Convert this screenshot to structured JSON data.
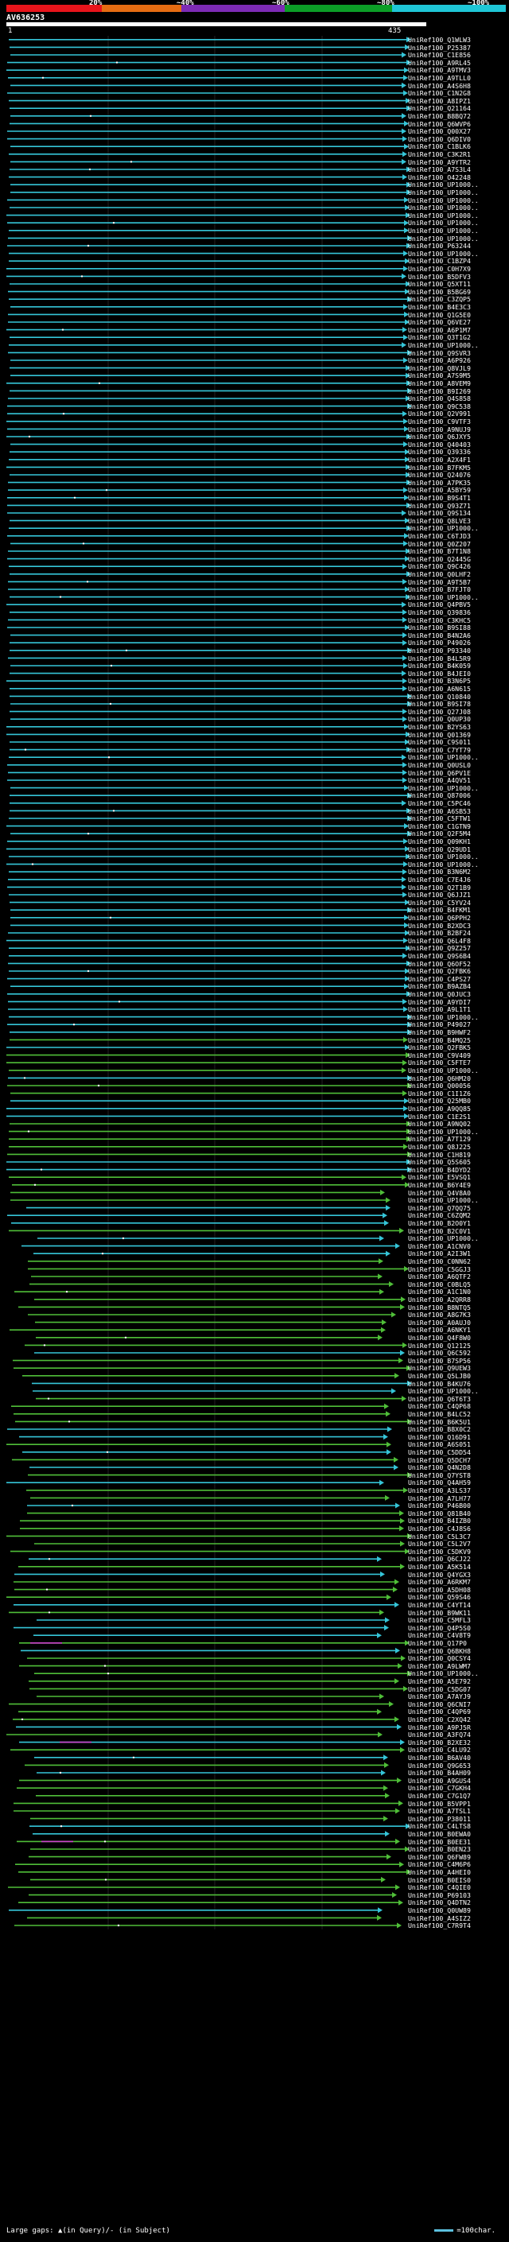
{
  "colors": {
    "bg": "#000000",
    "band": [
      "#e8141b",
      "#e66c12",
      "#7d2bb5",
      "#0c9e27",
      "#1fc6d6"
    ],
    "hit_high": "#35c5d8",
    "hit_mid": "#4fbe38",
    "gap": "#cc44cc",
    "grid": "#444444"
  },
  "header": {
    "pct_labels": [
      "20%",
      "~40%",
      "~60%",
      "~80%",
      "~100%"
    ],
    "query_id": "AV636253",
    "query_start": "1",
    "query_end": "435"
  },
  "hits": [
    "UniRef100_Q1WLW3",
    "UniRef100_P25387",
    "UniRef100_C1E856",
    "UniRef100_A9RL45",
    "UniRef100_A9TMV3",
    "UniRef100_A9TLL0",
    "UniRef100_A4S6H8",
    "UniRef100_C1N2G8",
    "UniRef100_A8IPZ1",
    "UniRef100_Q21164",
    "UniRef100_B8BQ72",
    "UniRef100_Q6WVP6",
    "UniRef100_Q00X27",
    "UniRef100_Q6DIV0",
    "UniRef100_C1BLK6",
    "UniRef100_C3K2R1",
    "UniRef100_A9YTR2",
    "UniRef100_A7S3L4",
    "UniRef100_O42248",
    "UniRef100_UP1000..",
    "UniRef100_UP1000..",
    "UniRef100_UP1000..",
    "UniRef100_UP1000..",
    "UniRef100_UP1000..",
    "UniRef100_UP1000..",
    "UniRef100_UP1000..",
    "UniRef100_UP1000..",
    "UniRef100_P63244",
    "UniRef100_UP1000..",
    "UniRef100_C1BZP4",
    "UniRef100_C0H7X9",
    "UniRef100_B5DFV3",
    "UniRef100_Q5XT11",
    "UniRef100_B5BG69",
    "UniRef100_C3ZQP5",
    "UniRef100_B4E3C3",
    "UniRef100_Q1G5E0",
    "UniRef100_Q6VE27",
    "UniRef100_A6P1M7",
    "UniRef100_Q3T1G2",
    "UniRef100_UP1000..",
    "UniRef100_Q9SVR3",
    "UniRef100_A6P926",
    "UniRef100_Q8VJL9",
    "UniRef100_A7S9M5",
    "UniRef100_A8VEM9",
    "UniRef100_B9I269",
    "UniRef100_Q4S858",
    "UniRef100_Q9C538",
    "UniRef100_Q2V991",
    "UniRef100_C9VTF3",
    "UniRef100_A9NUJ9",
    "UniRef100_Q6JXY5",
    "UniRef100_Q40403",
    "UniRef100_Q39336",
    "UniRef100_A2X4F1",
    "UniRef100_B7FKM5",
    "UniRef100_Q24076",
    "UniRef100_A7PK35",
    "UniRef100_A5BY59",
    "UniRef100_B9S4T1",
    "UniRef100_Q93Z71",
    "UniRef100_Q9S134",
    "UniRef100_Q8LVE3",
    "UniRef100_UP1000..",
    "UniRef100_C6TJD3",
    "UniRef100_Q0Z207",
    "UniRef100_B7T1N8",
    "UniRef100_Q2445G",
    "UniRef100_Q9C426",
    "UniRef100_Q0LHF2",
    "UniRef100_A9T5B7",
    "UniRef100_B7FJT0",
    "UniRef100_UP1000..",
    "UniRef100_Q4PBV5",
    "UniRef100_Q39836",
    "UniRef100_C3KHC5",
    "UniRef100_B9SI88",
    "UniRef100_B4N2A6",
    "UniRef100_P49026",
    "UniRef100_P93340",
    "UniRef100_B4L5R9",
    "UniRef100_B4K059",
    "UniRef100_B4JEI0",
    "UniRef100_B3N6P5",
    "UniRef100_A6N615",
    "UniRef100_Q10840",
    "UniRef100_B9SI78",
    "UniRef100_Q27J08",
    "UniRef100_Q0UP30",
    "UniRef100_B2YS63",
    "UniRef100_Q01369",
    "UniRef100_C9S011",
    "UniRef100_C7YT79",
    "UniRef100_UP1000..",
    "UniRef100_Q0USL0",
    "UniRef100_Q6PV1E",
    "UniRef100_A4QV51",
    "UniRef100_UP1000..",
    "UniRef100_Q87006",
    "UniRef100_C5PC46",
    "UniRef100_A6SB53",
    "UniRef100_C5FTW1",
    "UniRef100_C1GTN9",
    "UniRef100_Q2F5M4",
    "UniRef100_Q09KH1",
    "UniRef100_Q29UD1",
    "UniRef100_UP1000..",
    "UniRef100_UP1000..",
    "UniRef100_B3N6M2",
    "UniRef100_C7E4J6",
    "UniRef100_Q2T1B9",
    "UniRef100_Q6JJZ1",
    "UniRef100_C5YV24",
    "UniRef100_B4FKM1",
    "UniRef100_Q6PPH2",
    "UniRef100_B2XDC3",
    "UniRef100_B2BF24",
    "UniRef100_Q6L4F8",
    "UniRef100_Q9Z257",
    "UniRef100_Q9S6B4",
    "UniRef100_Q6OF52",
    "UniRef100_Q2FBK6",
    "UniRef100_C4PS27",
    "UniRef100_B9AZB4",
    "UniRef100_Q0JUC3",
    "UniRef100_A9YDI7",
    "UniRef100_A9L1T1",
    "UniRef100_UP1000..",
    "UniRef100_P49027",
    "UniRef100_B9HWF2",
    "UniRef100_B4MQ25",
    "UniRef100_Q2FBK5",
    "UniRef100_C9V409",
    "UniRef100_C5FTE7",
    "UniRef100_UP1000..",
    "UniRef100_Q6HM20",
    "UniRef100_Q00056",
    "UniRef100_C1I1Z6",
    "UniRef100_Q25MB0",
    "UniRef100_A9QQ85",
    "UniRef100_C1E2S1",
    "UniRef100_A9NQ02",
    "UniRef100_UP1000..",
    "UniRef100_A7T129",
    "UniRef100_Q8J225",
    "UniRef100_C1H819",
    "UniRef100_Q5S605",
    "UniRef100_B4DYD2",
    "UniRef100_E5VSQ1",
    "UniRef100_B6Y4E9",
    "UniRef100_Q4V8A0",
    "UniRef100_UP1000..",
    "UniRef100_Q7QQ75",
    "UniRef100_C6ZQM2",
    "UniRef100_B2O0Y1",
    "UniRef100_B2C0V1",
    "UniRef100_UP1000..",
    "UniRef100_A1CNV0",
    "UniRef100_A2I3W1",
    "UniRef100_C0NN62",
    "UniRef100_C5GGJ3",
    "UniRef100_A6QTF2",
    "UniRef100_C0BLQ5",
    "UniRef100_A1C1N0",
    "UniRef100_A2QRR8",
    "UniRef100_B8NTQ5",
    "UniRef100_A8G7K3",
    "UniRef100_A0AUJ0",
    "UniRef100_A6NKY1",
    "UniRef100_Q4F8W0",
    "UniRef100_Q12125",
    "UniRef100_Q6C592",
    "UniRef100_B7SP56",
    "UniRef100_Q9UEW3",
    "UniRef100_Q5LJB0",
    "UniRef100_B4KU76",
    "UniRef100_UP1000..",
    "UniRef100_Q6T6T3",
    "UniRef100_C4QP68",
    "UniRef100_B4LC52",
    "UniRef100_B6K5U1",
    "UniRef100_B8X0C2",
    "UniRef100_Q16D91",
    "UniRef100_A6S051",
    "UniRef100_C5DD54",
    "UniRef100_Q5DCH7",
    "UniRef100_Q4N2D8",
    "UniRef100_Q7YST8",
    "UniRef100_Q4AH59",
    "UniRef100_A3LS37",
    "UniRef100_A7LH77",
    "UniRef100_P46B00",
    "UniRef100_Q81B40",
    "UniRef100_B4IZB0",
    "UniRef100_C4J8S6",
    "UniRef100_C5L3C7",
    "UniRef100_C5L2V7",
    "UniRef100_C5DKV9",
    "UniRef100_Q6CJ22",
    "UniRef100_A5K514",
    "UniRef100_Q4YGX3",
    "UniRef100_A6RKM7",
    "UniRef100_A5DH08",
    "UniRef100_Q59S46",
    "UniRef100_C4YT14",
    "UniRef100_B9WK11",
    "UniRef100_C5MFL3",
    "UniRef100_Q4P5S0",
    "UniRef100_C4V8T9",
    "UniRef100_Q17P0",
    "UniRef100_Q6BKH8",
    "UniRef100_Q0CSY4",
    "UniRef100_A9LWM7",
    "UniRef100_UP1000..",
    "UniRef100_A5E792",
    "UniRef100_C5DG07",
    "UniRef100_A7AYJ9",
    "UniRef100_Q6CNI7",
    "UniRef100_C4QP69",
    "UniRef100_C2XQ42",
    "UniRef100_A9PJ5R",
    "UniRef100_A3FQ74",
    "UniRef100_B2XE32",
    "UniRef100_C4LU92",
    "UniRef100_B6AV40",
    "UniRef100_Q9G653",
    "UniRef100_B4AH09",
    "UniRef100_A9GUS4",
    "UniRef100_C7GKH4",
    "UniRef100_C7G1Q7",
    "UniRef100_B5VPP1",
    "UniRef100_A7TSL1",
    "UniRef100_P38011",
    "UniRef100_C4LTS8",
    "UniRef100_B0EWA0",
    "UniRef100_B0EE31",
    "UniRef100_B0EN23",
    "UniRef100_Q6FW89",
    "UniRef100_C4M6P6",
    "UniRef100_A4HEI0",
    "UniRef100_B0EIS0",
    "UniRef100_C4QIE0",
    "UniRef100_P69103",
    "UniRef100_Q4DTN2",
    "UniRef100_Q0UW89",
    "UniRef100_A4SIZ2",
    "UniRef100_C7R9T4"
  ],
  "footer": {
    "gaps_text": "Large gaps: ▲(in Query)/- (in Subject)",
    "scale_text": "=100char."
  }
}
